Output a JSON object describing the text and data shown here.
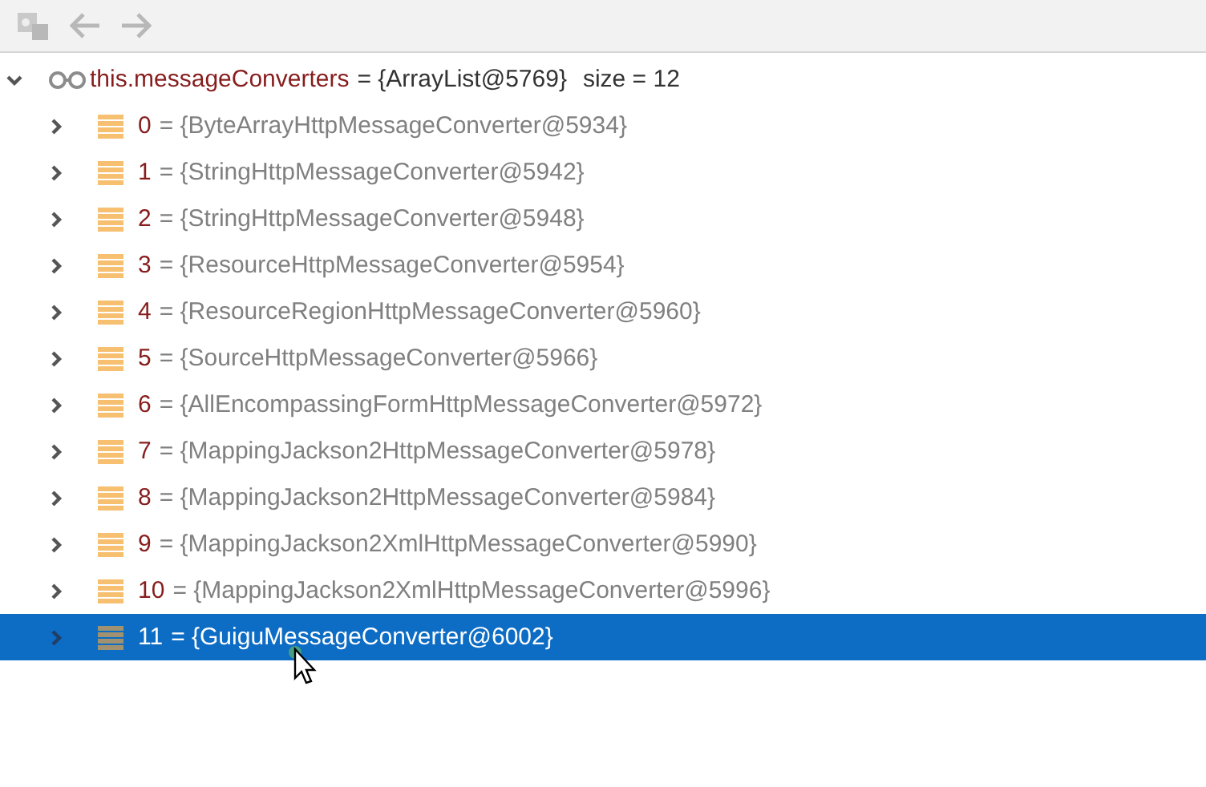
{
  "toolbar": {
    "buttons": [
      {
        "kind": "restore",
        "disabled": true
      },
      {
        "kind": "back",
        "disabled": true
      },
      {
        "kind": "forward",
        "disabled": true
      }
    ]
  },
  "tree": {
    "name": "this.messageConverters",
    "value": "= {ArrayList@5769}",
    "note": "size = 12",
    "expanded": true,
    "kind": "watch",
    "selected": false,
    "children": [
      {
        "name": "0",
        "value": "= {ByteArrayHttpMessageConverter@5934}",
        "expanded": false,
        "selected": false
      },
      {
        "name": "1",
        "value": "= {StringHttpMessageConverter@5942}",
        "expanded": false,
        "selected": false
      },
      {
        "name": "2",
        "value": "= {StringHttpMessageConverter@5948}",
        "expanded": false,
        "selected": false
      },
      {
        "name": "3",
        "value": "= {ResourceHttpMessageConverter@5954}",
        "expanded": false,
        "selected": false
      },
      {
        "name": "4",
        "value": "= {ResourceRegionHttpMessageConverter@5960}",
        "expanded": false,
        "selected": false
      },
      {
        "name": "5",
        "value": "= {SourceHttpMessageConverter@5966}",
        "expanded": false,
        "selected": false
      },
      {
        "name": "6",
        "value": "= {AllEncompassingFormHttpMessageConverter@5972}",
        "expanded": false,
        "selected": false
      },
      {
        "name": "7",
        "value": "= {MappingJackson2HttpMessageConverter@5978}",
        "expanded": false,
        "selected": false
      },
      {
        "name": "8",
        "value": "= {MappingJackson2HttpMessageConverter@5984}",
        "expanded": false,
        "selected": false
      },
      {
        "name": "9",
        "value": "= {MappingJackson2XmlHttpMessageConverter@5990}",
        "expanded": false,
        "selected": false
      },
      {
        "name": "10",
        "value": "= {MappingJackson2XmlHttpMessageConverter@5996}",
        "expanded": false,
        "selected": false
      },
      {
        "name": "11",
        "value": "= {GuiguMessageConverter@6002}",
        "expanded": false,
        "selected": true
      }
    ]
  }
}
